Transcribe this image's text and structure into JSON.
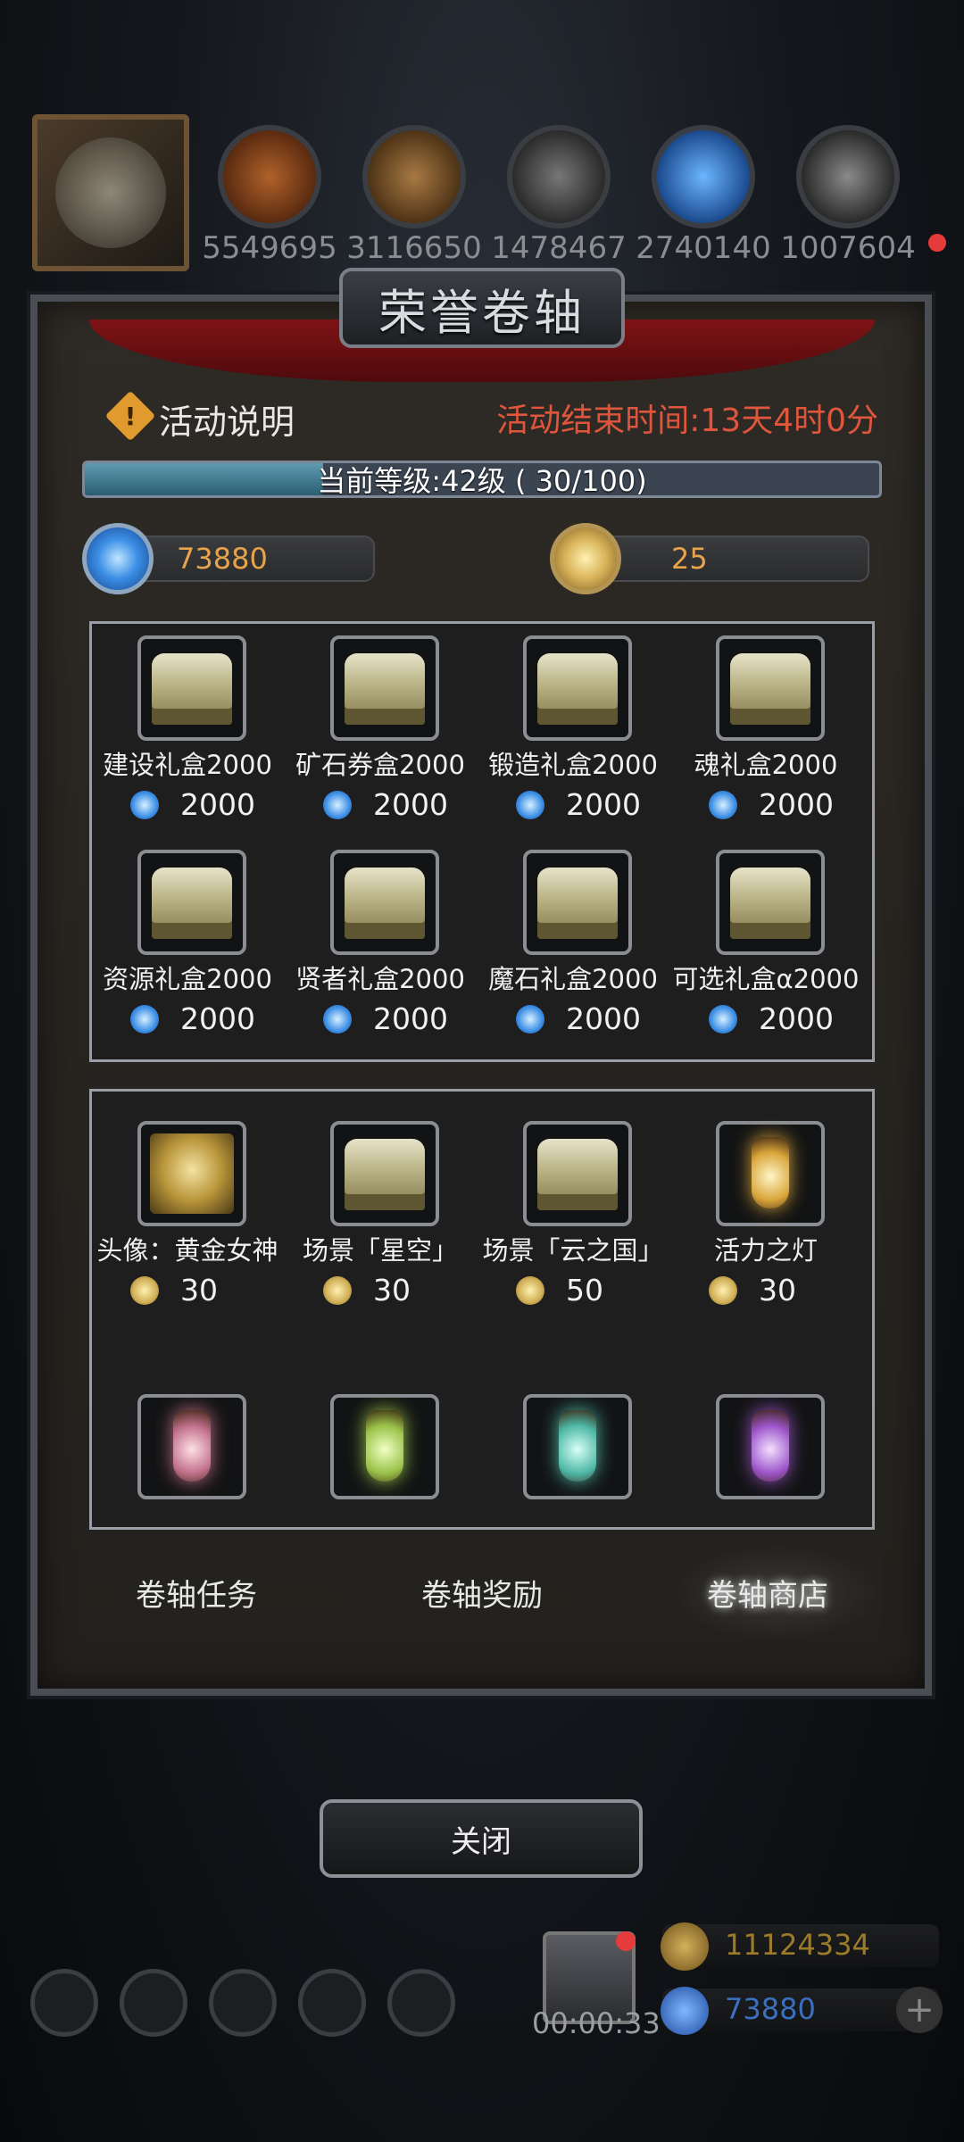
{
  "top_bar": {
    "resources": [
      {
        "icon": "meat-icon",
        "value": "5549695"
      },
      {
        "icon": "wood-icon",
        "value": "3116650"
      },
      {
        "icon": "stone-icon",
        "value": "1478467"
      },
      {
        "icon": "crystal-icon",
        "value": "2740140"
      },
      {
        "icon": "iron-icon",
        "value": "1007604"
      }
    ]
  },
  "panel": {
    "title": "荣誉卷轴",
    "info_label": "活动说明",
    "end_time": "活动结束时间:13天4时0分",
    "level_text": "当前等级:42级 ( 30/100)",
    "level_progress": 0.3,
    "gem_balance": "73880",
    "coin_balance": "25",
    "gem_shop": [
      {
        "name": "建设礼盒2000",
        "price": "2000"
      },
      {
        "name": "矿石券盒2000",
        "price": "2000"
      },
      {
        "name": "锻造礼盒2000",
        "price": "2000"
      },
      {
        "name": "魂礼盒2000",
        "price": "2000"
      },
      {
        "name": "资源礼盒2000",
        "price": "2000"
      },
      {
        "name": "贤者礼盒2000",
        "price": "2000"
      },
      {
        "name": "魔石礼盒2000",
        "price": "2000"
      },
      {
        "name": "可选礼盒α2000",
        "price": "2000"
      }
    ],
    "coin_shop": [
      {
        "name": "头像：黄金女神",
        "price": "30",
        "icon": "angel-statue-icon"
      },
      {
        "name": "场景「星空」",
        "price": "30",
        "icon": "chest-icon"
      },
      {
        "name": "场景「云之国」",
        "price": "50",
        "icon": "chest-icon"
      },
      {
        "name": "活力之灯",
        "price": "30",
        "icon": "lantern-icon"
      }
    ],
    "tabs": [
      "卷轴任务",
      "卷轴奖励",
      "卷轴商店"
    ],
    "active_tab": "卷轴商店"
  },
  "close_label": "关闭",
  "hud": {
    "timer": "00:00:33",
    "gold": "11124334",
    "gems": "73880",
    "plus": "+"
  },
  "colors": {
    "accent_orange": "#e0563c",
    "gold_text": "#e7a44a",
    "level_fill": "#5e9bb1"
  }
}
